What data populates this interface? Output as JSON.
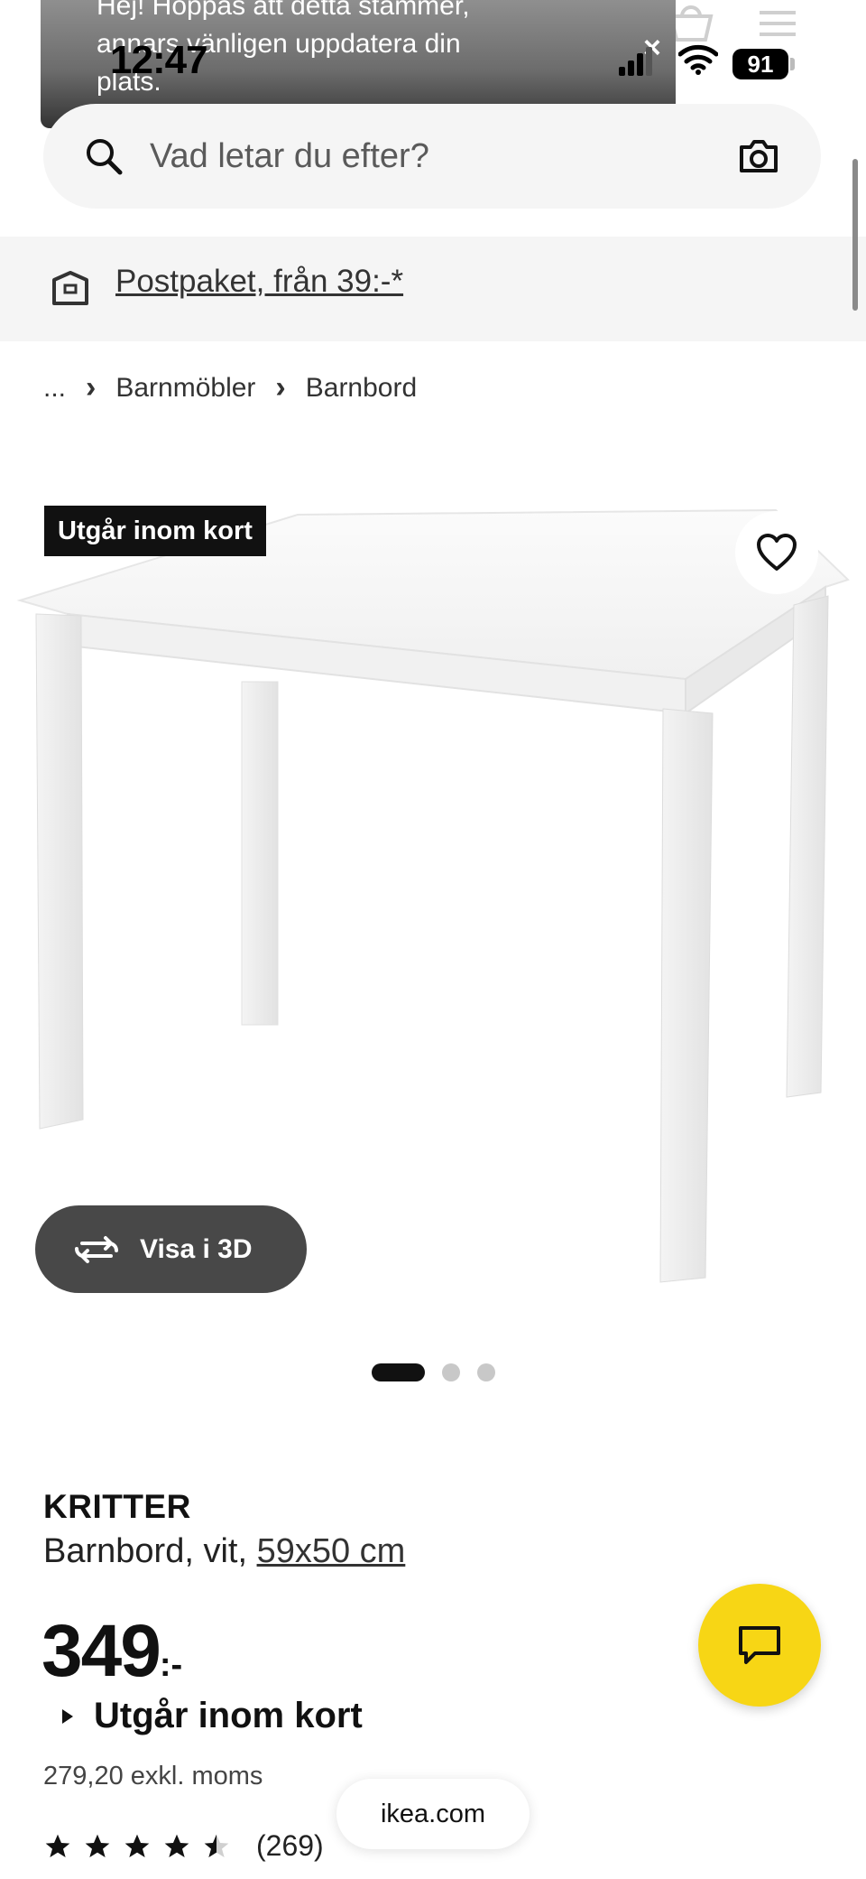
{
  "status_bar": {
    "time": "12:47",
    "battery": "91"
  },
  "notification": {
    "text": "Hej! Hoppas att detta stämmer, annars vänligen uppdatera din plats.",
    "close_glyph": "×"
  },
  "header": {
    "icons": [
      "shopping-bag-icon",
      "hamburger-menu-icon"
    ]
  },
  "search": {
    "placeholder": "Vad letar du efter?"
  },
  "delivery": {
    "label": "Postpaket, från 39:-*"
  },
  "breadcrumb": {
    "ellipsis": "...",
    "items": [
      "Barnmöbler",
      "Barnbord"
    ],
    "separator": "›"
  },
  "product": {
    "badge": "Utgår inom kort",
    "view3d_label": "Visa i 3D",
    "image_count": 3,
    "active_image": 1,
    "brand": "KRITTER",
    "description": "Barnbord, vit,",
    "size": "59x50 cm",
    "price": "349",
    "price_suffix": ":-",
    "availability": "Utgår inom kort",
    "price_ex_vat": "279,20 exkl. moms",
    "rating": 4.5,
    "rating_count": "(269)"
  },
  "browser": {
    "url": "ikea.com"
  },
  "colors": {
    "accent_yellow": "#F7D615",
    "badge_black": "#111111",
    "banner_gray": "#6C6C6C"
  }
}
